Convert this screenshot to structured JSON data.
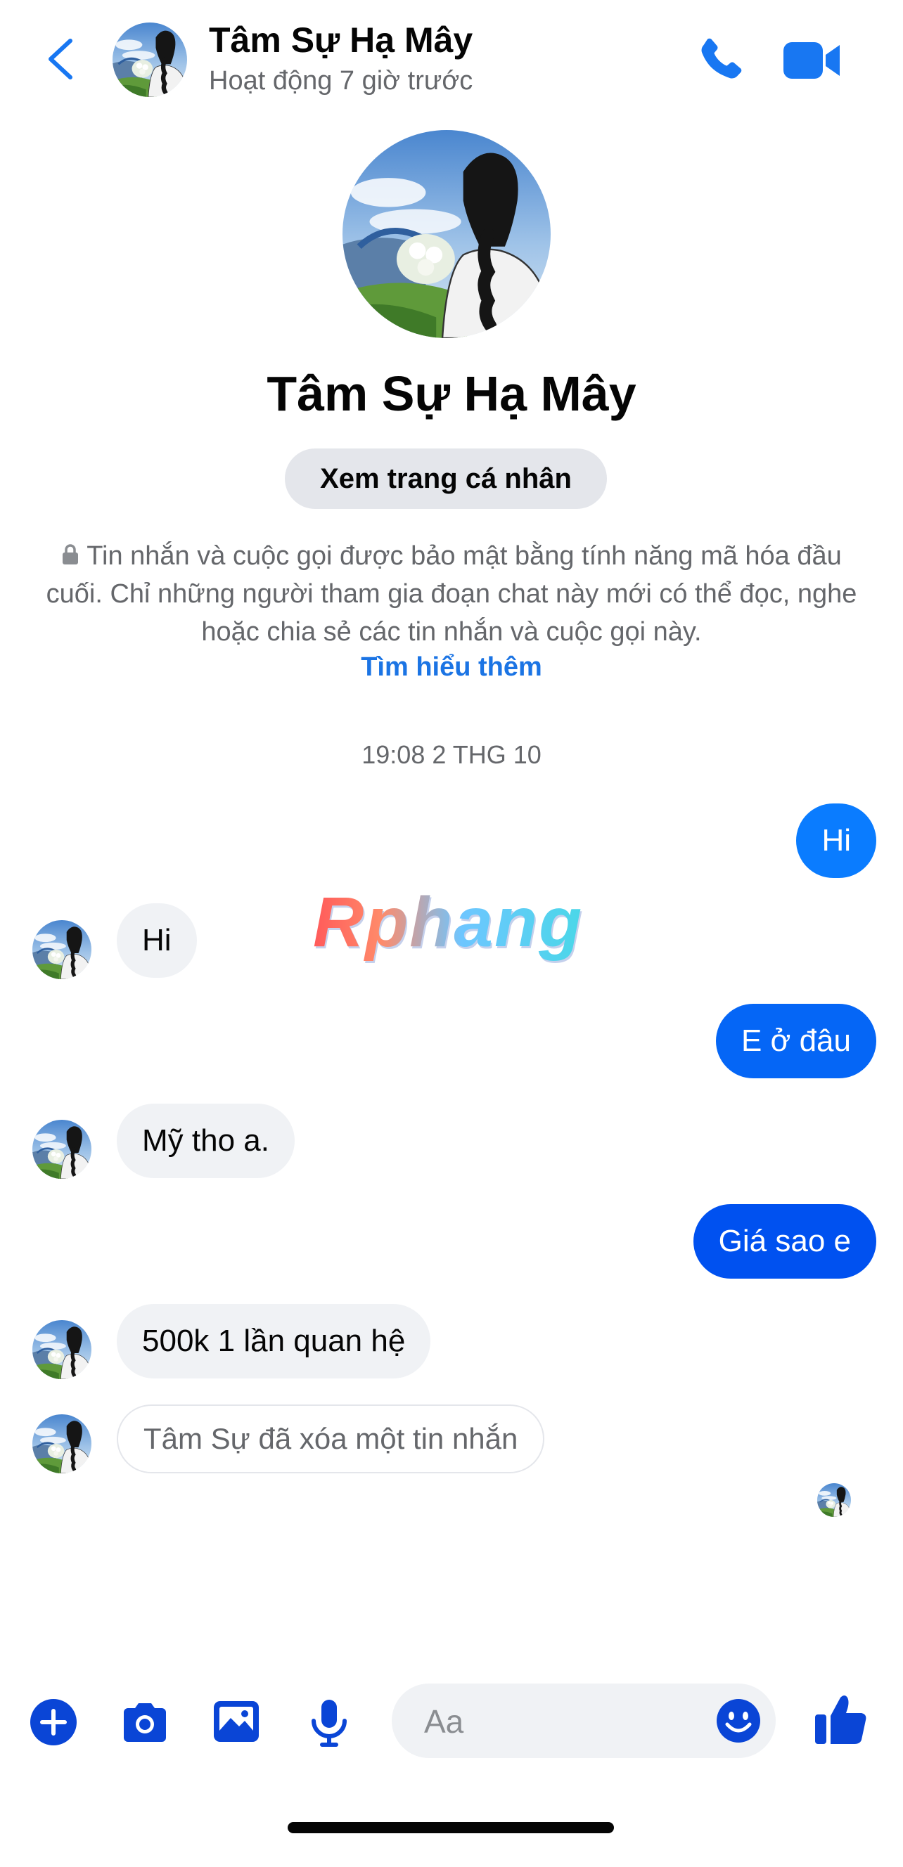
{
  "header": {
    "contact_name": "Tâm Sự Hạ Mây",
    "status": "Hoạt động 7 giờ trước",
    "icons": {
      "back": "chevron-left-icon",
      "call": "phone-icon",
      "video": "video-camera-icon"
    }
  },
  "profile": {
    "name": "Tâm Sự Hạ Mây",
    "view_profile_label": "Xem trang cá nhân"
  },
  "encryption_notice": {
    "text": "Tin nhắn và cuộc gọi được bảo mật bằng tính năng mã hóa đầu cuối. Chỉ những người tham gia đoạn chat này mới có thể đọc, nghe hoặc chia sẻ các tin nhắn và cuộc gọi này.",
    "learn_more": "Tìm hiểu thêm"
  },
  "timestamp": "19:08 2 THG 10",
  "messages": [
    {
      "direction": "out",
      "text": "Hi"
    },
    {
      "direction": "in",
      "text": "Hi"
    },
    {
      "direction": "out",
      "text": "E ở đâu"
    },
    {
      "direction": "in",
      "text": "Mỹ tho a."
    },
    {
      "direction": "out",
      "text": "Giá sao e"
    },
    {
      "direction": "in",
      "text": "500k 1 lần quan hệ"
    },
    {
      "direction": "in",
      "deleted": true,
      "text": "Tâm Sự đã xóa một tin nhắn"
    }
  ],
  "watermark": "Rphang",
  "composer": {
    "placeholder": "Aa",
    "icons": [
      "plus-icon",
      "camera-icon",
      "image-icon",
      "microphone-icon",
      "emoji-icon",
      "thumbs-up-icon"
    ]
  },
  "colors": {
    "accent": "#1877f2",
    "outgoing_bubble_light": "#0a7cff",
    "outgoing_bubble_dark": "#0051f0",
    "incoming_bubble": "#f0f2f5",
    "composer_icon": "#0a45d6"
  }
}
